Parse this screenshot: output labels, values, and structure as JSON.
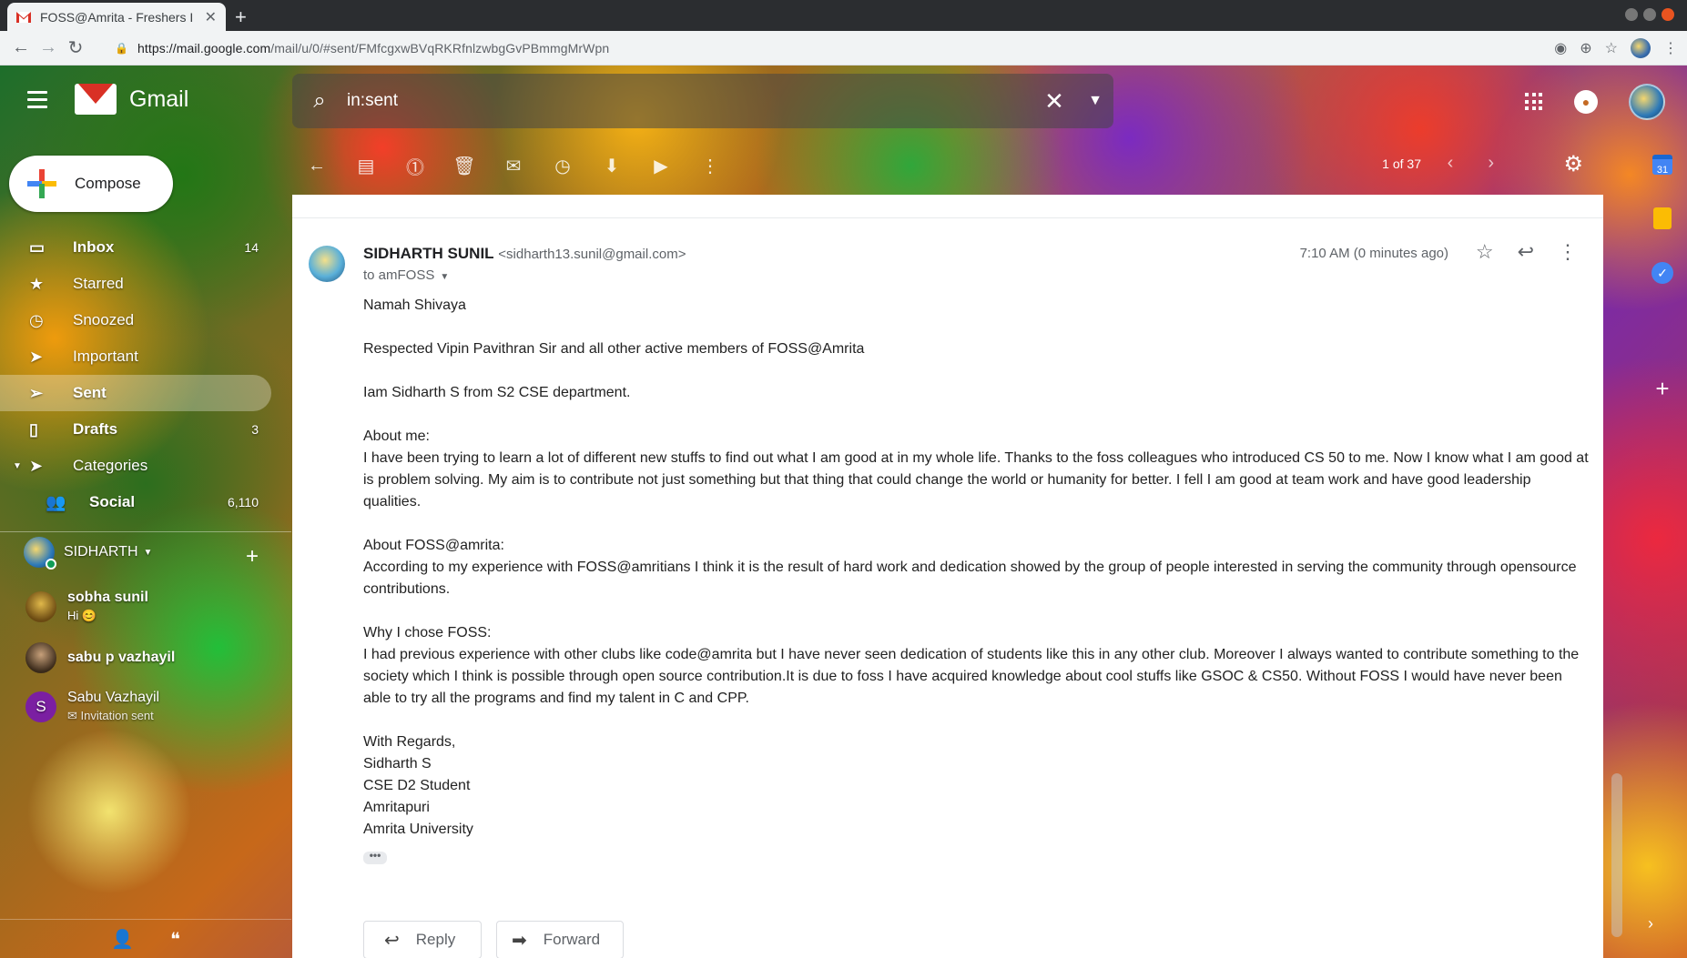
{
  "browser": {
    "tab_title": "FOSS@Amrita - Freshers I",
    "url_host": "https://mail.google.com",
    "url_path": "/mail/u/0/#sent/FMfcgxwBVqRKRfnlzwbgGvPBmmgMrWpn"
  },
  "header": {
    "app_name": "Gmail",
    "search_value": "in:sent"
  },
  "toolbar": {
    "pager": "1 of 37",
    "icons": [
      "back-arrow-icon",
      "archive-icon",
      "report-spam-icon",
      "delete-icon",
      "mark-unread-icon",
      "snooze-icon",
      "move-to-inbox-icon",
      "label-icon",
      "more-vert-icon"
    ]
  },
  "compose": {
    "label": "Compose"
  },
  "sidebar": {
    "items": [
      {
        "label": "Inbox",
        "count": "14",
        "icon": "inbox-icon"
      },
      {
        "label": "Starred",
        "count": "",
        "icon": "star-icon"
      },
      {
        "label": "Snoozed",
        "count": "",
        "icon": "clock-icon"
      },
      {
        "label": "Important",
        "count": "",
        "icon": "important-icon"
      },
      {
        "label": "Sent",
        "count": "",
        "icon": "send-icon"
      },
      {
        "label": "Drafts",
        "count": "3",
        "icon": "draft-icon"
      },
      {
        "label": "Categories",
        "count": "",
        "icon": "label-icon"
      },
      {
        "label": "Social",
        "count": "6,110",
        "icon": "people-icon"
      }
    ]
  },
  "hangouts": {
    "user": "SIDHARTH",
    "contacts": [
      {
        "name": "sobha sunil",
        "status": "Hi 😊"
      },
      {
        "name": "sabu p vazhayil",
        "status": ""
      },
      {
        "name": "Sabu Vazhayil",
        "status": "Invitation sent",
        "initial": "S"
      }
    ]
  },
  "email": {
    "sender_name": "SIDHARTH SUNIL",
    "sender_email": "<sidharth13.sunil@gmail.com>",
    "to": "to amFOSS",
    "time": "7:10 AM (0 minutes ago)",
    "greeting": "Namah Shivaya",
    "p1": "Respected Vipin Pavithran Sir and all other active members of FOSS@Amrita",
    "p2": "Iam Sidharth S from S2 CSE department.",
    "about_me_h": "About me:",
    "about_me": "I have been trying to learn a lot of different new stuffs to find out what I am good at in my whole life. Thanks to the foss colleagues who introduced CS 50 to me. Now I know what I am good at is problem solving. My aim is to contribute not just something but that thing that could change the world or humanity for better. I fell I am good at team work and have good leadership qualities.",
    "about_foss_h": "About FOSS@amrita:",
    "about_foss": "According to my experience with FOSS@amritians I think it is the result of hard work and dedication showed by the group of people interested in serving the community through opensource contributions.",
    "why_h": "Why I chose FOSS:",
    "why": "I had previous experience with other clubs like code@amrita but I have never seen dedication of students like this in any other club. Moreover I always wanted to contribute something to the society which I think is possible through open source contribution.It is due to foss I have acquired knowledge about cool stuffs like GSOC & CS50. Without FOSS I would have never been able to try all the programs and find my talent in C and CPP.",
    "sig": [
      "With Regards,",
      "Sidharth S",
      "CSE D2 Student",
      "Amritapuri",
      "Amrita University"
    ],
    "ellipsis": "•••",
    "reply_label": "Reply",
    "forward_label": "Forward"
  },
  "side_panel": {
    "calendar_day": "31"
  }
}
